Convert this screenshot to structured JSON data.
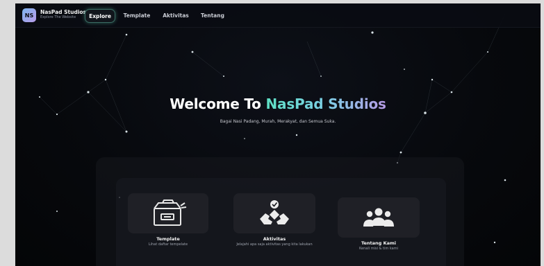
{
  "brand": {
    "logo_text": "NS",
    "name": "NasPad Studios",
    "tagline": "Explore The Website"
  },
  "nav": {
    "tabs": [
      {
        "label": "Explore",
        "active": true
      },
      {
        "label": "Template",
        "active": false
      },
      {
        "label": "Aktivitas",
        "active": false
      },
      {
        "label": "Tentang",
        "active": false
      }
    ]
  },
  "hero": {
    "title_prefix": "Welcome To ",
    "title_accent": "NasPad Studios",
    "subtitle": "Bagai Nasi Padang, Murah, Merakyat, dan Semua Suka."
  },
  "cards": [
    {
      "title": "Template",
      "desc": "Lihat daftar tempelate",
      "icon": "file-cabinet-icon"
    },
    {
      "title": "Aktivitas",
      "desc": "Jelajahi apa saja aktivitas yang kita lakukan",
      "icon": "helping-hands-icon"
    },
    {
      "title": "Tentang Kami",
      "desc": "Kenali misi & tim kami",
      "icon": "team-group-icon"
    }
  ],
  "colors": {
    "accent_start": "#5ee0c4",
    "accent_end": "#b79ae6",
    "background": "#07090d"
  }
}
